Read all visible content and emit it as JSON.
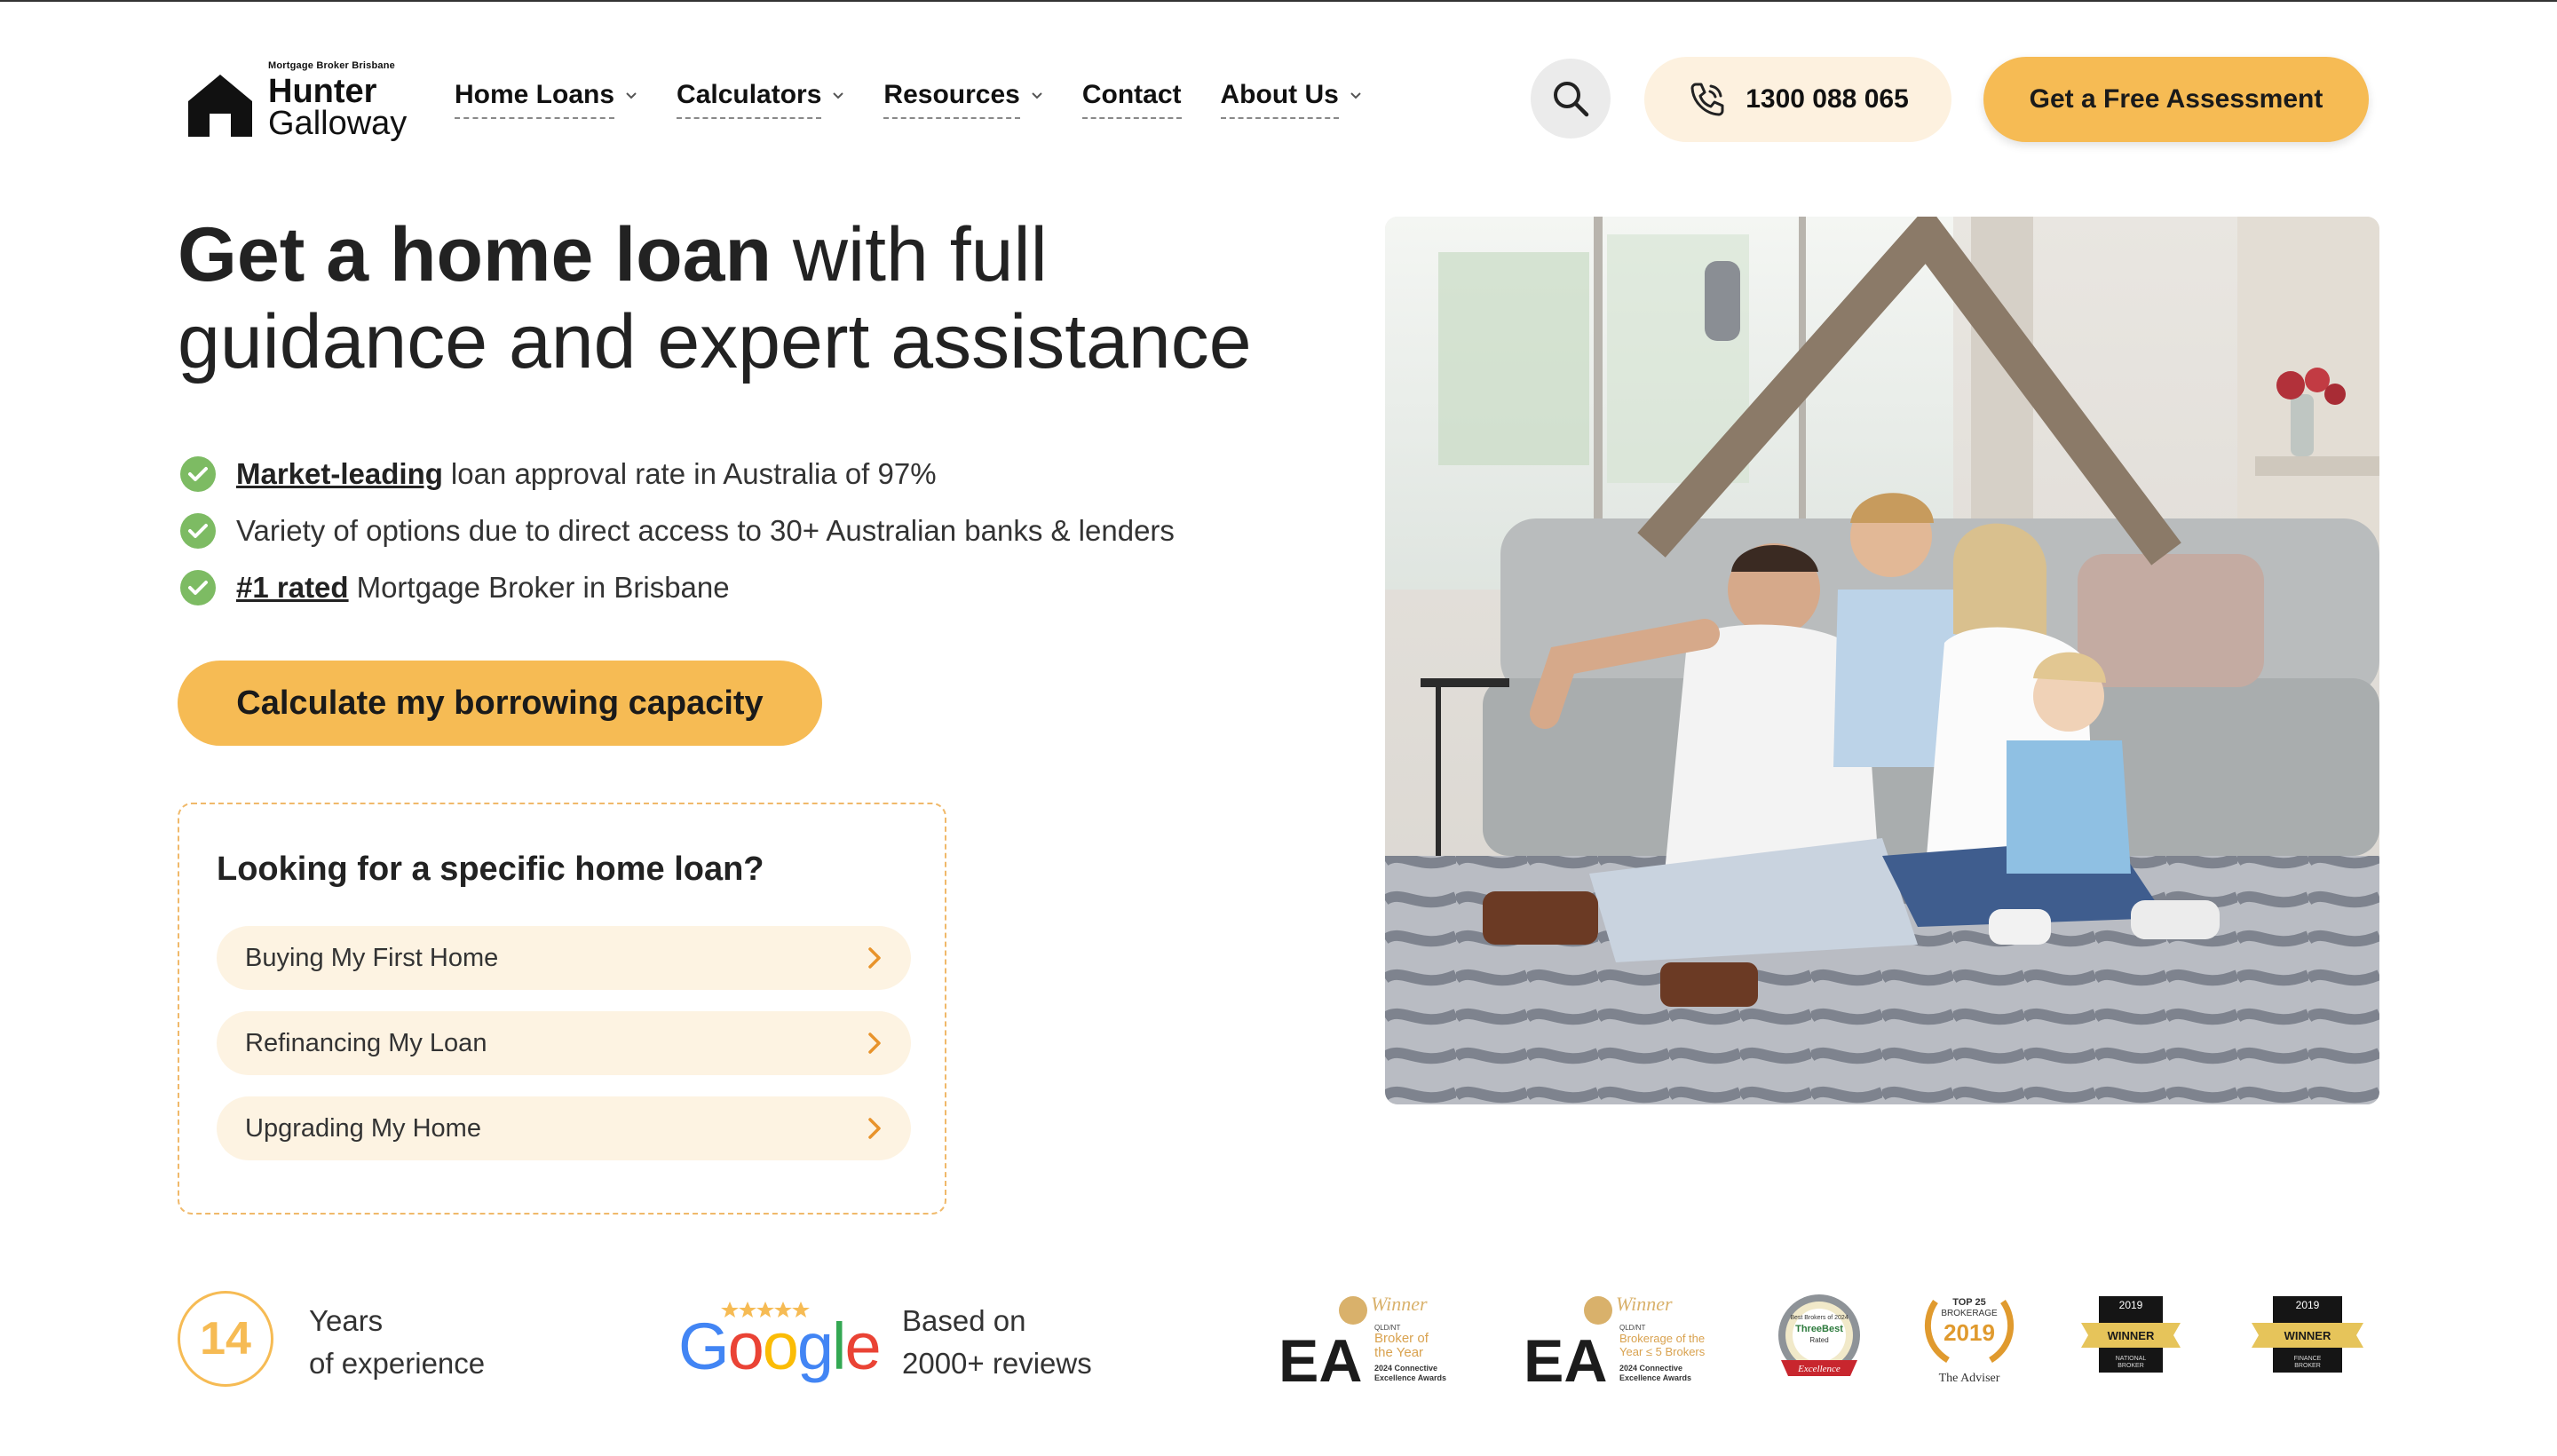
{
  "brand": {
    "tagline": "Mortgage Broker Brisbane",
    "name_line1": "Hunter",
    "name_line2": "Galloway"
  },
  "nav": {
    "items": [
      {
        "label": "Home Loans",
        "has_dropdown": true
      },
      {
        "label": "Calculators",
        "has_dropdown": true
      },
      {
        "label": "Resources",
        "has_dropdown": true
      },
      {
        "label": "Contact",
        "has_dropdown": false
      },
      {
        "label": "About Us",
        "has_dropdown": true
      }
    ],
    "phone": "1300 088 065",
    "cta": "Get a Free Assessment"
  },
  "hero": {
    "title_strong": "Get a home loan",
    "title_rest_1": " with full",
    "title_rest_2": "guidance and expert assistance",
    "bullets": [
      {
        "emphasis": "Market-leading",
        "text": "loan approval rate in Australia of 97%"
      },
      {
        "emphasis": "",
        "text": "Variety of options due to direct access to 30+ Australian banks & lenders"
      },
      {
        "emphasis": "#1 rated",
        "text": "Mortgage Broker in Brisbane"
      }
    ],
    "cta": "Calculate my borrowing capacity"
  },
  "loan_finder": {
    "title": "Looking for a specific home loan?",
    "options": [
      "Buying My First Home",
      "Refinancing My Loan",
      "Upgrading My Home"
    ]
  },
  "trust": {
    "years_value": "14",
    "years_line1": "Years",
    "years_line2": "of experience",
    "google_word": "Google",
    "reviews_line1": "Based on",
    "reviews_line2": "2000+ reviews",
    "awards": [
      {
        "mark": "EA",
        "line1": "Winner",
        "line2": "QLD/NT",
        "line3": "Broker of",
        "line4": "the Year",
        "line5": "2024 Connective",
        "line6": "Excellence Awards"
      },
      {
        "mark": "EA",
        "line1": "Winner",
        "line2": "QLD/NT",
        "line3": "Brokerage of the",
        "line4": "Year ≤ 5 Brokers",
        "line5": "2024 Connective",
        "line6": "Excellence Awards"
      },
      {
        "line1": "Best Brokers of 2024",
        "line2": "ThreeBest",
        "line3": "Rated",
        "line4": "Excellence"
      },
      {
        "line1": "TOP 25",
        "line2": "BROKERAGE",
        "line3": "2019",
        "line4": "The Adviser"
      },
      {
        "line1": "2019",
        "line2": "WINNER"
      },
      {
        "line1": "2019",
        "line2": "WINNER",
        "line3": "FINANCE",
        "line4": "BROKER"
      }
    ]
  },
  "colors": {
    "accent": "#f6bb54",
    "accent_light": "#fdf3e2",
    "check_green": "#7dbb63",
    "text": "#222222"
  }
}
